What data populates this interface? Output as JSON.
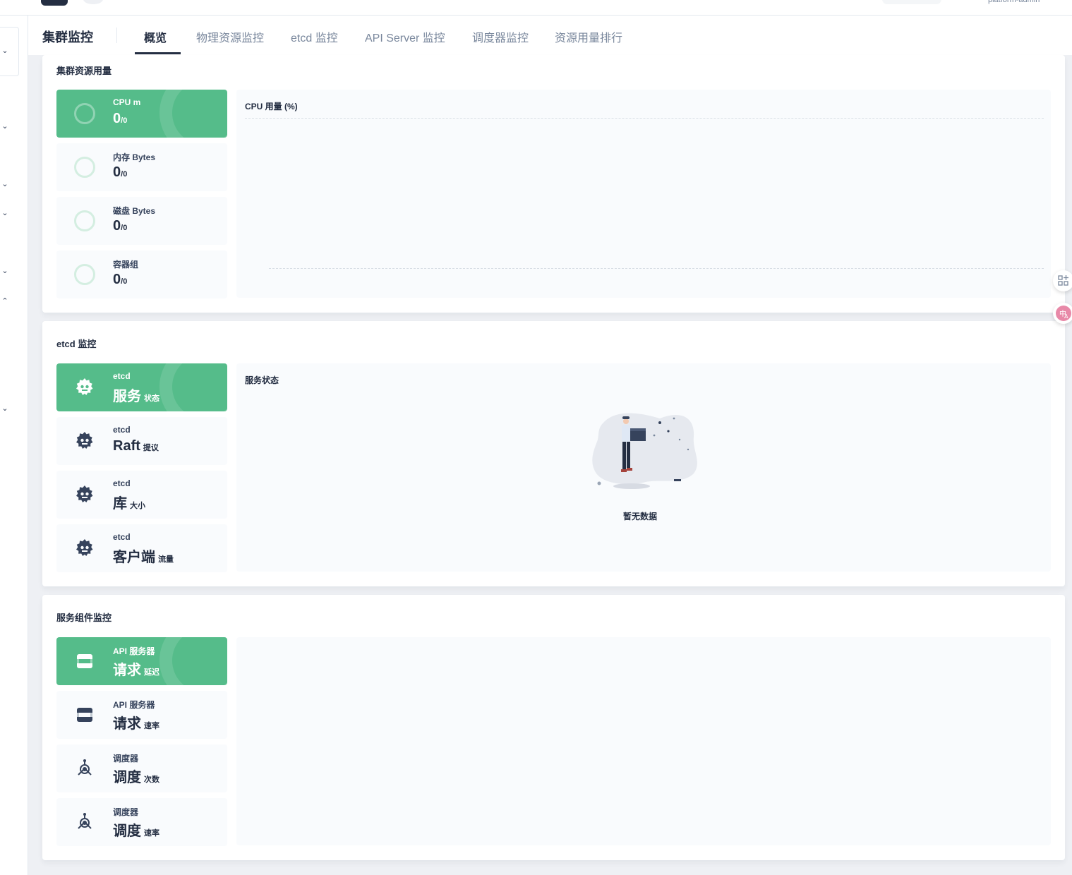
{
  "header": {
    "user_text": "platform-admin"
  },
  "page": {
    "title": "集群监控",
    "tabs": [
      {
        "label": "概览",
        "active": true
      },
      {
        "label": "物理资源监控"
      },
      {
        "label": "etcd 监控"
      },
      {
        "label": "API Server 监控"
      },
      {
        "label": "调度器监控"
      },
      {
        "label": "资源用量排行"
      }
    ]
  },
  "resource_usage": {
    "title": "集群资源用量",
    "cards": [
      {
        "label": "CPU m",
        "value": "0",
        "total": "0",
        "active": true
      },
      {
        "label": "内存 Bytes",
        "value": "0",
        "total": "0"
      },
      {
        "label": "磁盘 Bytes",
        "value": "0",
        "total": "0"
      },
      {
        "label": "容器组",
        "value": "0",
        "total": "0"
      }
    ],
    "chart_title": "CPU 用量 (%)"
  },
  "etcd": {
    "title": "etcd 监控",
    "cards": [
      {
        "label": "etcd",
        "value": "服务",
        "unit": "状态",
        "icon": "etcd-icon",
        "active": true
      },
      {
        "label": "etcd",
        "value": "Raft",
        "unit": "提议",
        "icon": "etcd-icon"
      },
      {
        "label": "etcd",
        "value": "库",
        "unit": "大小",
        "icon": "etcd-icon"
      },
      {
        "label": "etcd",
        "value": "客户端",
        "unit": "流量",
        "icon": "etcd-icon"
      }
    ],
    "chart_title": "服务状态",
    "empty_text": "暂无数据"
  },
  "components": {
    "title": "服务组件监控",
    "cards": [
      {
        "label": "API 服务器",
        "value": "请求",
        "unit": "延迟",
        "icon": "api-server-icon",
        "active": true
      },
      {
        "label": "API 服务器",
        "value": "请求",
        "unit": "速率",
        "icon": "api-server-icon"
      },
      {
        "label": "调度器",
        "value": "调度",
        "unit": "次数",
        "icon": "scheduler-icon"
      },
      {
        "label": "调度器",
        "value": "调度",
        "unit": "速率",
        "icon": "scheduler-icon"
      }
    ]
  },
  "colors": {
    "accent": "#55bc8a",
    "text": "#242e42",
    "muted": "#79879c",
    "bg": "#eef0f4"
  }
}
